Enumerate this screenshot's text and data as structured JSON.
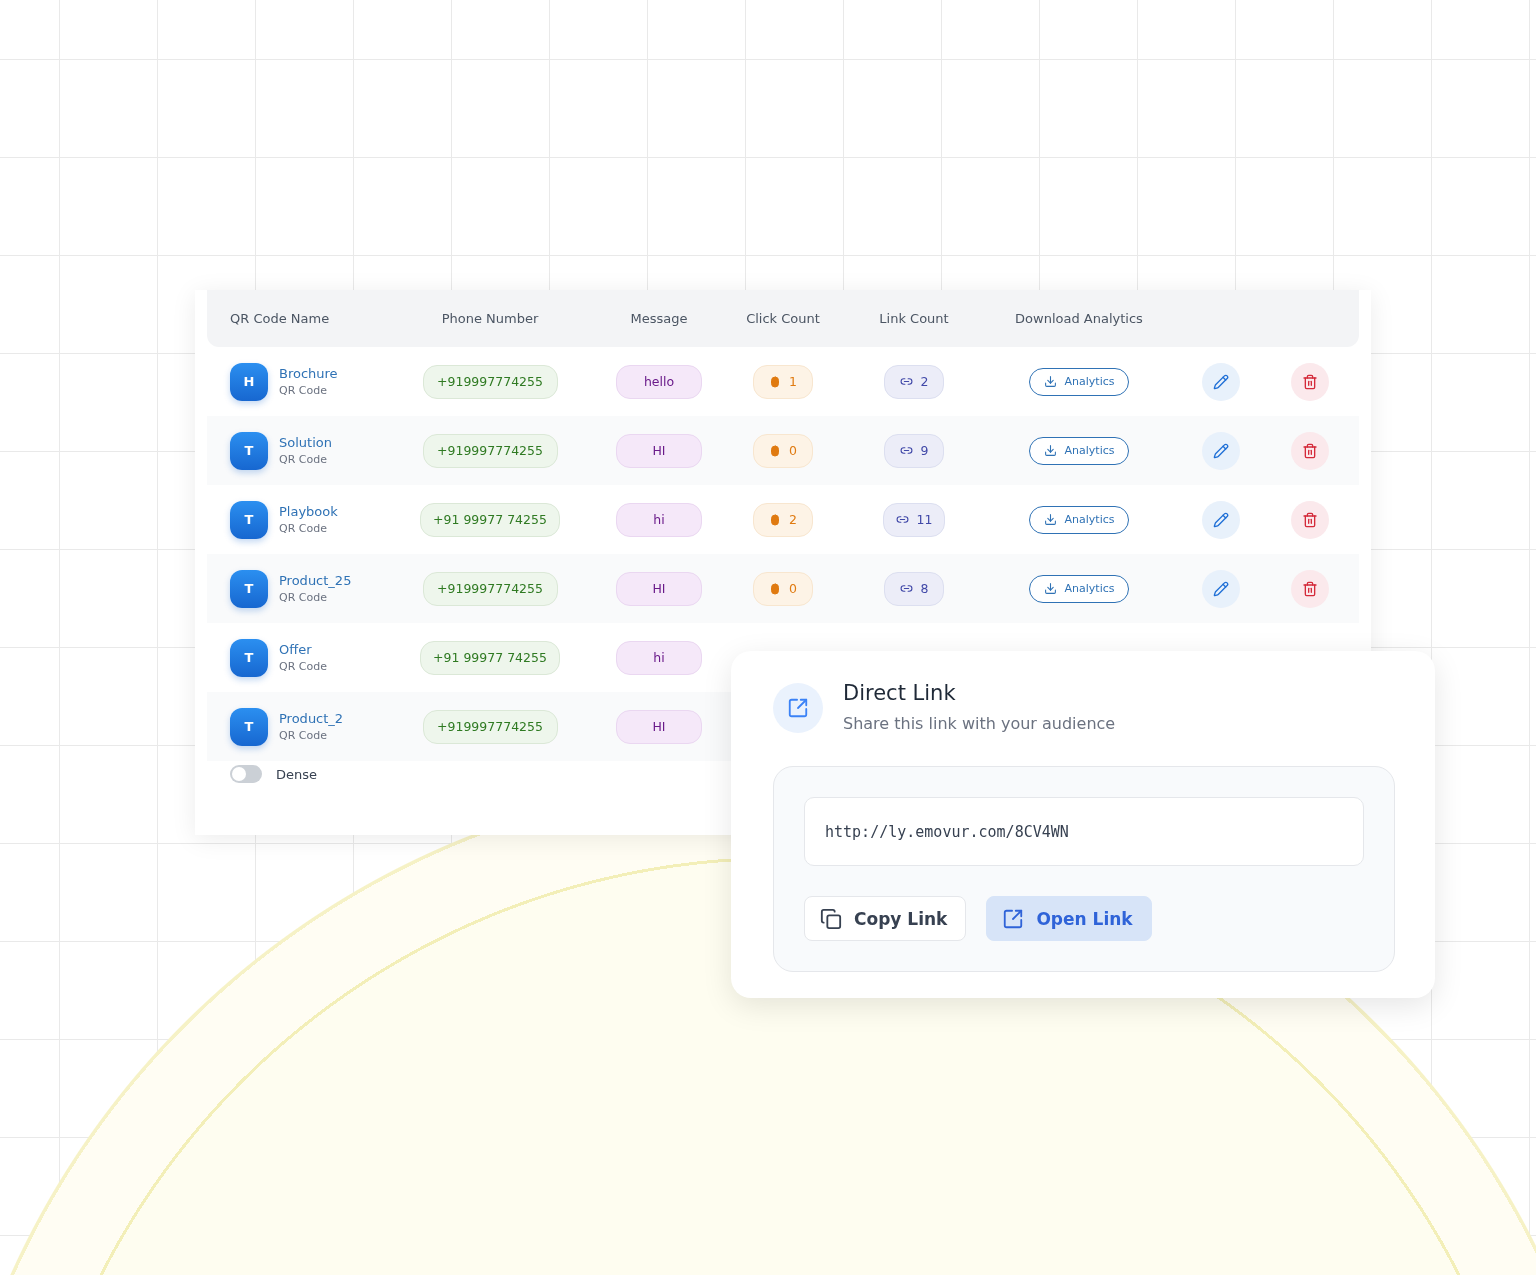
{
  "table": {
    "columns": [
      "QR Code Name",
      "Phone Number",
      "Message",
      "Click Count",
      "Link Count",
      "Download Analytics"
    ],
    "rows": [
      {
        "avatar": "H",
        "name": "Brochure",
        "type": "QR Code",
        "phone": "+919997774255",
        "message": "hello",
        "clicks": "1",
        "links": "2",
        "analytics": "Analytics"
      },
      {
        "avatar": "T",
        "name": "Solution",
        "type": "QR Code",
        "phone": "+919997774255",
        "message": "HI",
        "clicks": "0",
        "links": "9",
        "analytics": "Analytics"
      },
      {
        "avatar": "T",
        "name": "Playbook",
        "type": "QR Code",
        "phone": "+91 99977 74255",
        "message": "hi",
        "clicks": "2",
        "links": "11",
        "analytics": "Analytics"
      },
      {
        "avatar": "T",
        "name": "Product_25",
        "type": "QR Code",
        "phone": "+919997774255",
        "message": "HI",
        "clicks": "0",
        "links": "8",
        "analytics": "Analytics"
      },
      {
        "avatar": "T",
        "name": "Offer",
        "type": "QR Code",
        "phone": "+91 99977 74255",
        "message": "hi"
      },
      {
        "avatar": "T",
        "name": "Product_2",
        "type": "QR Code",
        "phone": "+919997774255",
        "message": "HI"
      }
    ]
  },
  "dense": {
    "label": "Dense",
    "on": false
  },
  "popup": {
    "title": "Direct Link",
    "subtitle": "Share this link with your audience",
    "url": "http://ly.emovur.com/8CV4WN",
    "copy": "Copy Link",
    "open": "Open Link"
  }
}
